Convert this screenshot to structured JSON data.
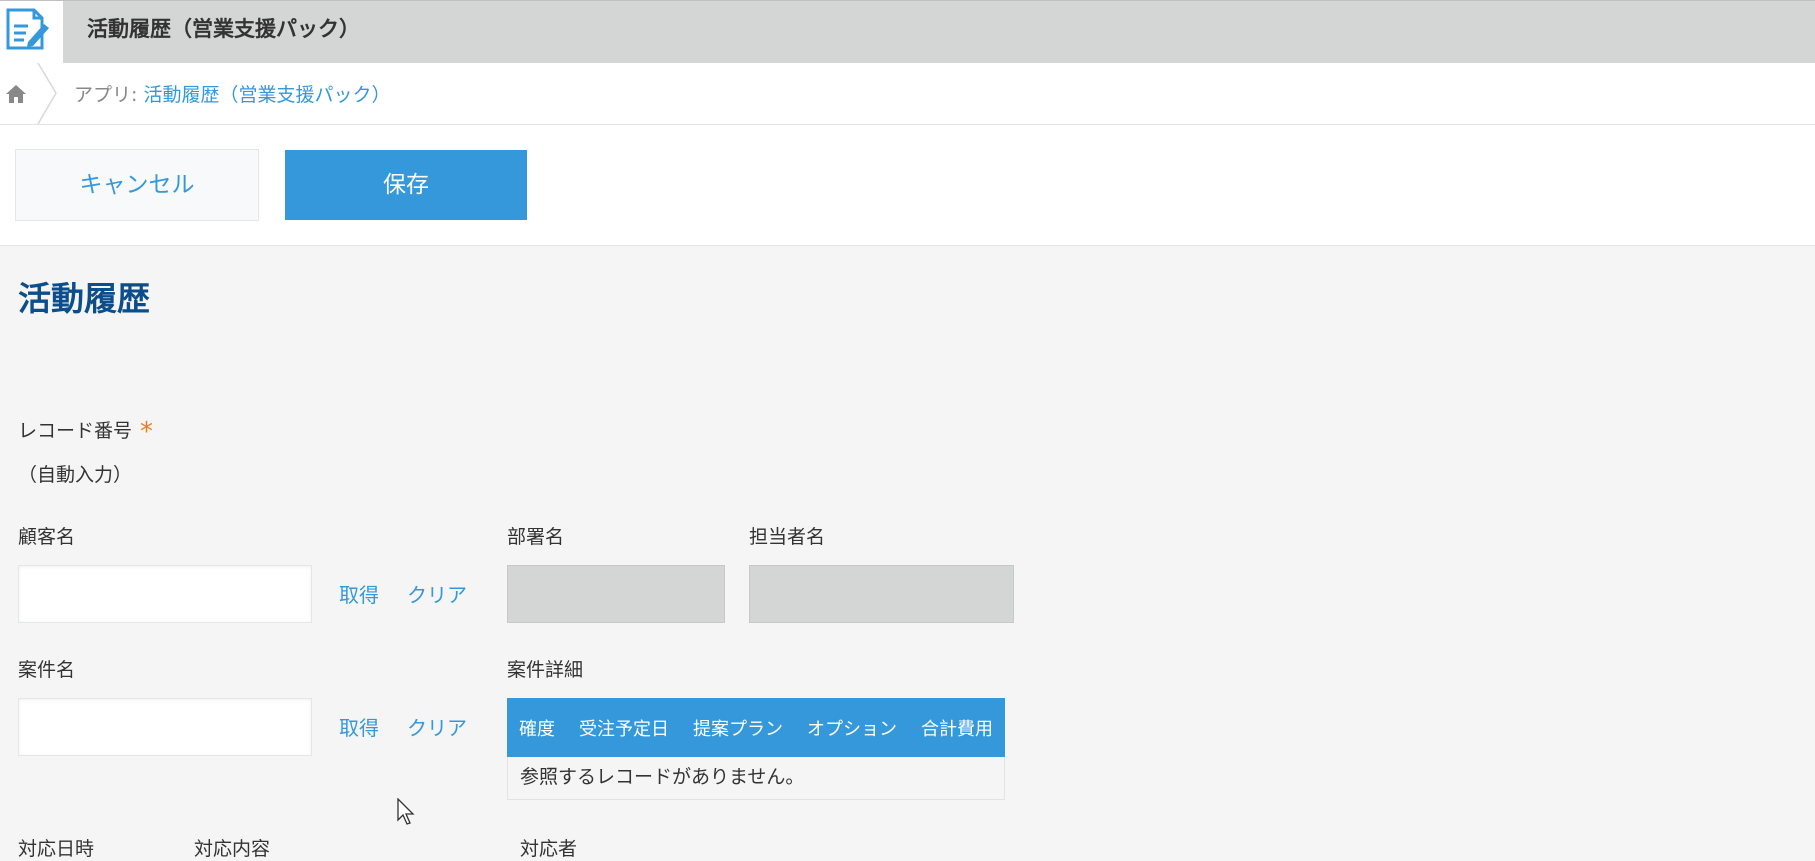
{
  "header": {
    "app_title": "活動履歴（営業支援パック）"
  },
  "breadcrumb": {
    "prefix": "アプリ:",
    "app_link": "活動履歴（営業支援パック）"
  },
  "toolbar": {
    "cancel_label": "キャンセル",
    "save_label": "保存"
  },
  "form": {
    "title": "活動履歴",
    "record_number": {
      "label": "レコード番号",
      "required_mark": "*",
      "value": "（自動入力）"
    },
    "customer": {
      "label": "顧客名",
      "fetch_label": "取得",
      "clear_label": "クリア"
    },
    "department": {
      "label": "部署名"
    },
    "contact_person": {
      "label": "担当者名"
    },
    "deal": {
      "label": "案件名",
      "fetch_label": "取得",
      "clear_label": "クリア"
    },
    "deal_details": {
      "label": "案件詳細",
      "columns": [
        "確度",
        "受注予定日",
        "提案プラン",
        "オプション",
        "合計費用"
      ],
      "empty_message": "参照するレコードがありません。"
    },
    "bottom_labels": {
      "date": "対応日時",
      "content": "対応内容",
      "responder": "対応者"
    }
  },
  "colors": {
    "accent": "#3498db",
    "title_blue": "#0c4e8c",
    "required": "#e67e22",
    "header_gray": "#d4d5d5"
  }
}
